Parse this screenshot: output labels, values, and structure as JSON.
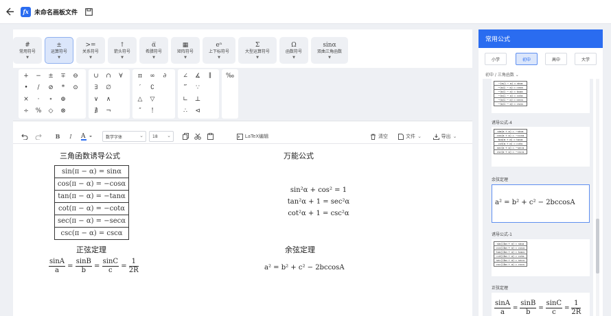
{
  "header": {
    "title": "未命名画板文件",
    "logo_text": "fx"
  },
  "symbol_tabs": [
    {
      "glyph": "#",
      "label": "常用符号"
    },
    {
      "glyph": "±",
      "label": "运算符号"
    },
    {
      "glyph": ">=",
      "label": "关系符号"
    },
    {
      "glyph": "↑",
      "label": "箭头符号"
    },
    {
      "glyph": "α̅",
      "label": "希腊符号"
    },
    {
      "glyph": "▦",
      "label": "矩阵符号"
    },
    {
      "glyph": "eⁿ",
      "label": "上下标符号"
    },
    {
      "glyph": "Σ",
      "label": "大型运算符号"
    },
    {
      "glyph": "Ω",
      "label": "函数符号"
    },
    {
      "glyph": "sinα",
      "label": "双曲三角函数"
    }
  ],
  "palette": {
    "g1": [
      "+",
      "−",
      "±",
      "∓",
      "⊖",
      "•",
      "/",
      "⊘",
      "*",
      "⊙",
      "×",
      "·",
      "∘",
      "⊕",
      "÷",
      "%",
      "◇",
      "⊗"
    ],
    "g2": [
      "∪",
      "∩",
      "∀",
      "∃",
      "∅",
      "∨",
      "∧",
      "∄",
      "¬"
    ],
    "g3": [
      "π",
      "∞",
      "∂",
      "′",
      "∁",
      "△",
      "▽",
      "″",
      "!"
    ],
    "g4": [
      "∠",
      "∡",
      "∥",
      "‴",
      "∵",
      "∟",
      "⊥",
      "∴",
      "⊲"
    ],
    "g5": [
      "‰"
    ]
  },
  "toolbar": {
    "font": "数学字体",
    "size": "18",
    "latex": "LaTeX编辑",
    "clear": "清空",
    "file": "文件",
    "export": "导出"
  },
  "canvas": {
    "h1": "三角函数诱导公式",
    "h2": "万能公式",
    "h3": "正弦定理",
    "h4": "余弦定理",
    "trig_rows": [
      "sin(π − α) = sinα",
      "cos(π − α) = −cosα",
      "tan(π − α) = −tanα",
      "cot(π − α) = −cotα",
      "sec(π − α) = −secα",
      "csc(π − α) = cscα"
    ],
    "wan": [
      "sin²α + cos² = 1",
      "tan²α + 1 = sec²α",
      "cot²α + 1 = csc²α"
    ],
    "sine_law": {
      "n1": "sinA",
      "d1": "a",
      "n2": "sinB",
      "d2": "b",
      "n3": "sinC",
      "d3": "c",
      "n4": "1",
      "d4": "2R"
    },
    "cosine_law": "a² = b² + c² − 2bccosA"
  },
  "sidebar": {
    "title": "常用公式",
    "levels": [
      "小学",
      "初中",
      "高中",
      "大学"
    ],
    "crumb": "初中 / 三角函数",
    "card1_rows": [
      "−(π/2 − α) = sinα",
      "−(π/2 − α) = cosα",
      "−(π/2 − α) = tanα",
      "−(π/2 − α) = cotα",
      "−(π/2 − α) = secα",
      "−(π/2 − α) = cscα"
    ],
    "card2_title": "诱导公式-4",
    "card2_rows": [
      "sin(π + α) = −sinα",
      "cos(π + α) = −cosα",
      "tan(π + α) = tanα",
      "cot(π + α) = cotα",
      "sec(π + α) = −secα",
      "csc(π + α) = −cscα"
    ],
    "card3_title": "余弦定理",
    "card3_formula": "a² = b² + c² − 2bccosA",
    "card4_title": "诱导公式-1",
    "card4_rows": [
      "sin(2kπ + α) = sinα",
      "cos(2kπ + α) = cosα",
      "tan(2kπ + α) = tanα",
      "cot(2kπ + α) = cotα",
      "sec(2kπ + α) = secα",
      "csc(2kπ + α) = cscα"
    ],
    "card5_title": "正弦定理",
    "card5_sine": {
      "n1": "sinA",
      "d1": "a",
      "n2": "sinB",
      "d2": "b",
      "n3": "sinC",
      "d3": "c",
      "n4": "1",
      "d4": "2R"
    }
  },
  "colors": {
    "accent": "#2a6cf0",
    "panel": "#eef0f4"
  }
}
